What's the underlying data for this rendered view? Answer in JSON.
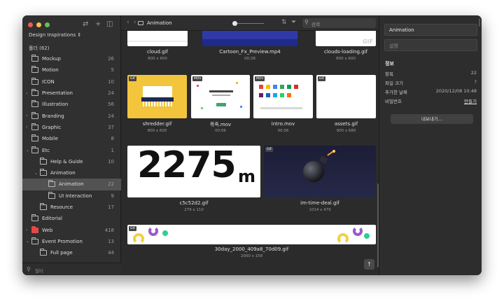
{
  "sidebar": {
    "library_title": "Design Inspirations ⇕",
    "all_count": "폴더 (62)",
    "filter_placeholder": "필터",
    "items": [
      {
        "label": "Mockup",
        "count": "26",
        "level": 0,
        "chevron": "",
        "selected": false,
        "red": false
      },
      {
        "label": "Motion",
        "count": "5",
        "level": 0,
        "chevron": "",
        "selected": false,
        "red": false
      },
      {
        "label": "ICON",
        "count": "10",
        "level": 0,
        "chevron": "",
        "selected": false,
        "red": false
      },
      {
        "label": "Presentation",
        "count": "24",
        "level": 0,
        "chevron": "›",
        "selected": false,
        "red": false
      },
      {
        "label": "Illustration",
        "count": "56",
        "level": 0,
        "chevron": "",
        "selected": false,
        "red": false
      },
      {
        "label": "Branding",
        "count": "24",
        "level": 0,
        "chevron": "›",
        "selected": false,
        "red": false
      },
      {
        "label": "Graphic",
        "count": "37",
        "level": 0,
        "chevron": "›",
        "selected": false,
        "red": false
      },
      {
        "label": "Mobile",
        "count": "8",
        "level": 0,
        "chevron": "",
        "selected": false,
        "red": false
      },
      {
        "label": "Etc",
        "count": "1",
        "level": 0,
        "chevron": "⌄",
        "selected": false,
        "red": false
      },
      {
        "label": "Help & Guide",
        "count": "10",
        "level": 1,
        "chevron": "",
        "selected": false,
        "red": false
      },
      {
        "label": "Animation",
        "count": "",
        "level": 1,
        "chevron": "⌄",
        "selected": false,
        "red": false
      },
      {
        "label": "Animation",
        "count": "22",
        "level": 2,
        "chevron": "",
        "selected": true,
        "red": false
      },
      {
        "label": "UI Interaction",
        "count": "9",
        "level": 2,
        "chevron": "",
        "selected": false,
        "red": false
      },
      {
        "label": "Resource",
        "count": "17",
        "level": 1,
        "chevron": "",
        "selected": false,
        "red": false
      },
      {
        "label": "Editorial",
        "count": "",
        "level": 0,
        "chevron": "",
        "selected": false,
        "red": false
      },
      {
        "label": "Web",
        "count": "418",
        "level": 0,
        "chevron": "›",
        "selected": false,
        "red": true
      },
      {
        "label": "Event Promotion",
        "count": "13",
        "level": 0,
        "chevron": "⌄",
        "selected": false,
        "red": false
      },
      {
        "label": "Full page",
        "count": "44",
        "level": 1,
        "chevron": "",
        "selected": false,
        "red": false
      }
    ]
  },
  "toolbar": {
    "back_icon": "chevron-left-icon",
    "forward_icon": "chevron-right-icon",
    "title": "Animation",
    "search_placeholder": "검색"
  },
  "assets": [
    {
      "name": "cloud.gif",
      "meta": "800 x 600"
    },
    {
      "name": "Cartoon_Fx_Preview.mp4",
      "meta": "00:28"
    },
    {
      "name": "clouds-loading.gif",
      "meta": "800 x 600"
    },
    {
      "name": "shredder.gif",
      "meta": "800 x 600",
      "badge": "GIF"
    },
    {
      "name": "폭죽.mov",
      "meta": "00:06",
      "badge": "MOV"
    },
    {
      "name": "intro.mov",
      "meta": "00:06",
      "badge": "MOV"
    },
    {
      "name": "assets.gif",
      "meta": "900 x 680",
      "badge": "GIF"
    },
    {
      "name": "c5c52d2.gif",
      "meta": "279 x 110",
      "thumb_text": "2275",
      "thumb_unit": "m"
    },
    {
      "name": "im-time-deal.gif",
      "meta": "1014 x 479",
      "badge": "GIF"
    },
    {
      "name": "30day_2000_409a8_70d09.gif",
      "meta": "2000 x 158",
      "badge": "GIF"
    }
  ],
  "thumb_texts": {
    "clouds_gif_mark": "GIF"
  },
  "inspector": {
    "name_value": "Animation",
    "desc_placeholder": "설명",
    "info_heading": "정보",
    "rows": [
      {
        "label": "항목",
        "value": "22"
      },
      {
        "label": "파일 크기",
        "value": "?"
      },
      {
        "label": "추가한 날짜",
        "value": "2020/12/08 10:48"
      },
      {
        "label": "비밀번호",
        "value": "만들기"
      }
    ],
    "export_label": "내보내기..."
  },
  "colors": {
    "window_bg": "#2b2b2b",
    "sidebar_bg": "#303030",
    "selected_row": "#525252",
    "traffic_red": "#ee5c54",
    "traffic_yellow": "#f6be4f",
    "traffic_green": "#5fc454",
    "web_folder": "#e04a4a"
  }
}
